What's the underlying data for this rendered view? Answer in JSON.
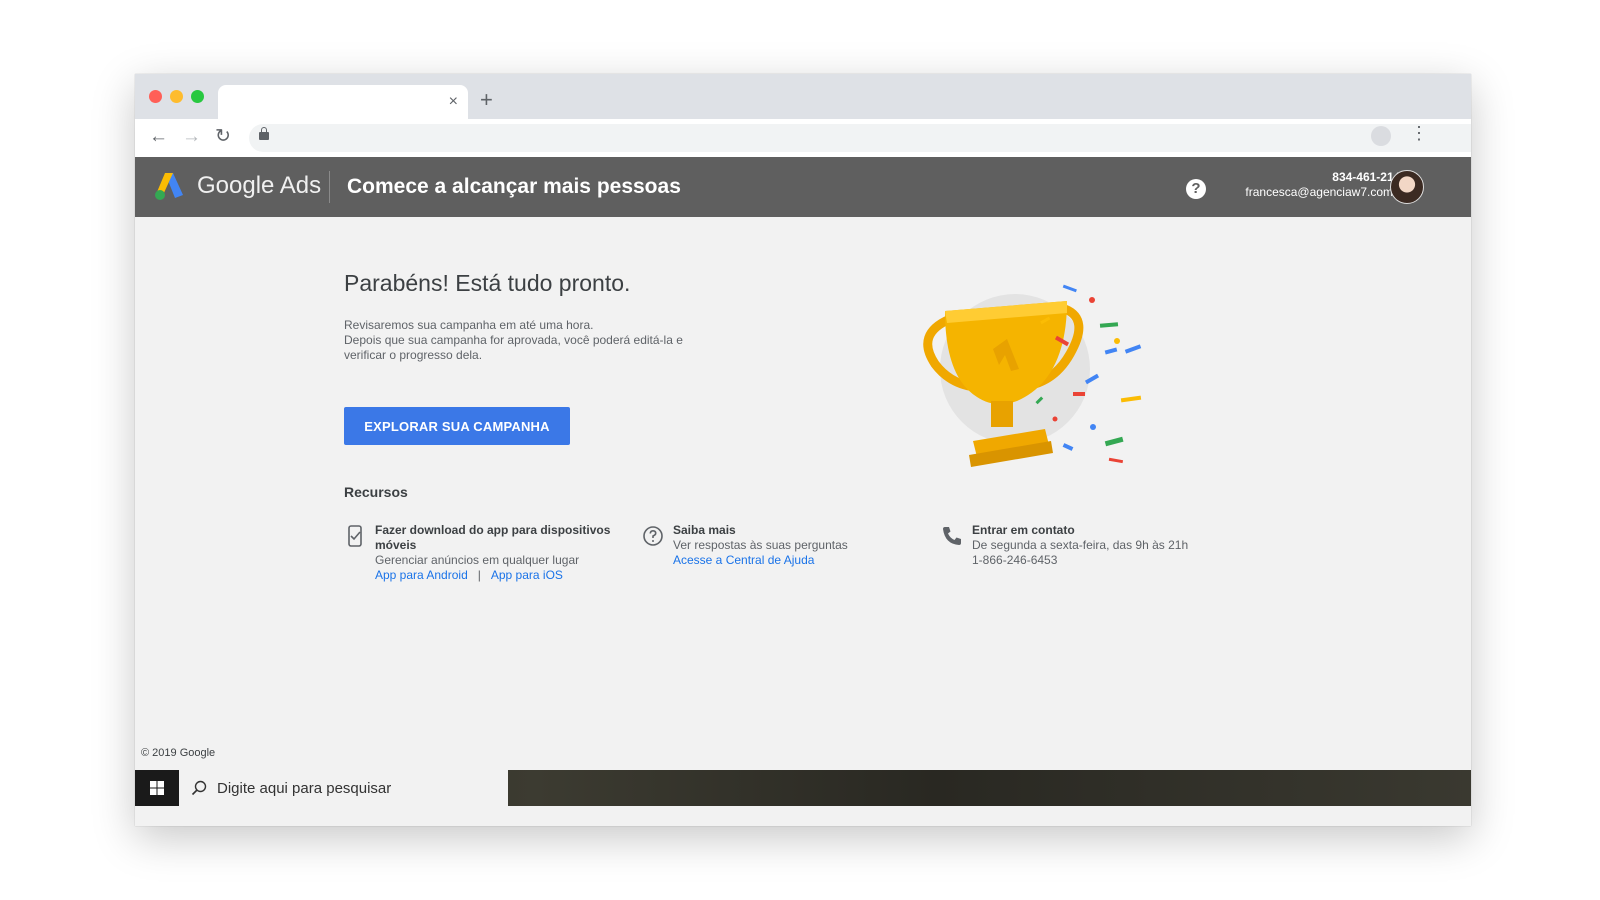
{
  "browser": {
    "tab_close": "×",
    "new_tab": "+",
    "back": "←",
    "forward": "→",
    "reload": "↻",
    "bookmark_star": "☆",
    "menu_dots": "⋮"
  },
  "header": {
    "brand": "Google Ads",
    "title": "Comece a alcançar mais pessoas",
    "help_symbol": "?",
    "phone": "834-461-2145",
    "email": "francesca@agenciaw7.com.br"
  },
  "main": {
    "heading": "Parabéns! Está tudo pronto.",
    "description_lines": [
      "Revisaremos sua campanha em até uma hora.",
      "Depois que sua campanha for aprovada, você poderá editá-la e",
      "verificar o progresso dela."
    ],
    "cta_label": "EXPLORAR SUA CAMPANHA",
    "resources_title": "Recursos",
    "resources": [
      {
        "icon": "mobile-download-icon",
        "title_lines": [
          "Fazer download do app para dispositivos",
          "móveis"
        ],
        "text": "Gerenciar anúncios em qualquer lugar",
        "links": [
          "App para Android",
          "App para iOS"
        ],
        "separator": "|"
      },
      {
        "icon": "help-circle-icon",
        "title": "Saiba mais",
        "text": "Ver respostas às suas perguntas",
        "link": "Acesse a Central de Ajuda"
      },
      {
        "icon": "phone-icon",
        "title": "Entrar em contato",
        "text": "De segunda a sexta-feira, das 9h às 21h",
        "phone": "1-866-246-6453"
      }
    ]
  },
  "footer": {
    "copyright": "© 2019 Google"
  },
  "taskbar": {
    "search_placeholder": "Digite aqui para pesquisar"
  },
  "colors": {
    "header_bg": "#5f5f5f",
    "cta_bg": "#3b78e7",
    "link": "#1a73e8",
    "trophy": "#f5b400"
  }
}
